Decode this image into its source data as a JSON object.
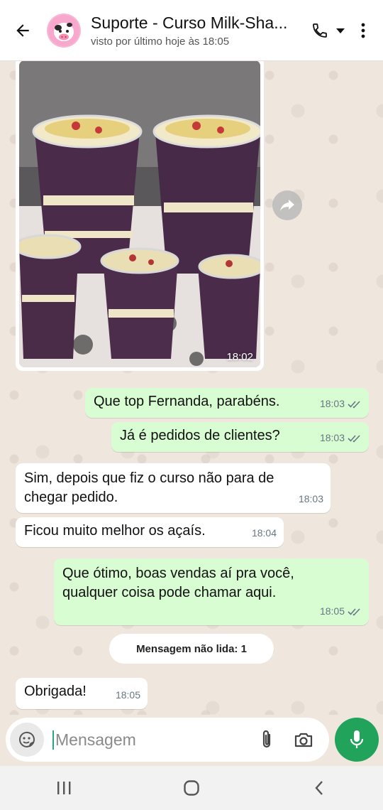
{
  "header": {
    "contact_name": "Suporte - Curso Milk-Sha...",
    "status": "visto por último hoje às 18:05",
    "icons": [
      "back-arrow-icon",
      "avatar-cow-icon",
      "phone-icon",
      "dropdown-icon",
      "more-vert-icon"
    ]
  },
  "chat": {
    "photo_message": {
      "time": "18:02"
    },
    "messages": [
      {
        "direction": "out",
        "text": "Que top Fernanda, parabéns.",
        "time": "18:03",
        "status": "read"
      },
      {
        "direction": "out",
        "text": "Já é pedidos de clientes?",
        "time": "18:03",
        "status": "read"
      },
      {
        "direction": "in",
        "text": "Sim, depois que fiz o curso não para de chegar pedido.",
        "time": "18:03"
      },
      {
        "direction": "in",
        "text": "Ficou muito melhor os açaís.",
        "time": "18:04"
      },
      {
        "direction": "out",
        "text": "Que ótimo, boas vendas aí pra você, qualquer coisa pode chamar aqui.",
        "time": "18:05",
        "status": "read"
      },
      {
        "direction": "in",
        "text": "Obrigada!",
        "time": "18:05"
      }
    ],
    "unread_banner": "Mensagem não lida: 1"
  },
  "input": {
    "placeholder": "Mensagem"
  },
  "colors": {
    "outgoing_bubble": "#d9fdd3",
    "incoming_bubble": "#ffffff",
    "accent_green": "#21a35b",
    "read_ticks": "#667781"
  }
}
